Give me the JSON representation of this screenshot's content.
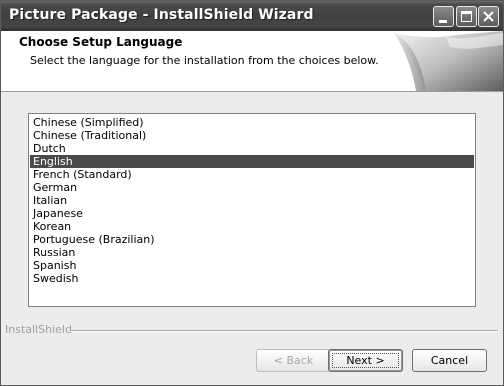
{
  "window": {
    "title": "Picture Package - InstallShield Wizard"
  },
  "header": {
    "title": "Choose Setup Language",
    "subtitle": "Select the language for the installation from the choices below."
  },
  "languages": {
    "items": [
      "Chinese (Simplified)",
      "Chinese (Traditional)",
      "Dutch",
      "English",
      "French (Standard)",
      "German",
      "Italian",
      "Japanese",
      "Korean",
      "Portuguese (Brazilian)",
      "Russian",
      "Spanish",
      "Swedish"
    ],
    "selected": "English"
  },
  "footer": {
    "brand": "InstallShield",
    "back_label": "< Back",
    "next_label": "Next >",
    "cancel_label": "Cancel"
  },
  "colors": {
    "selection": "#4a4a4a",
    "titlebar": "#404040"
  }
}
